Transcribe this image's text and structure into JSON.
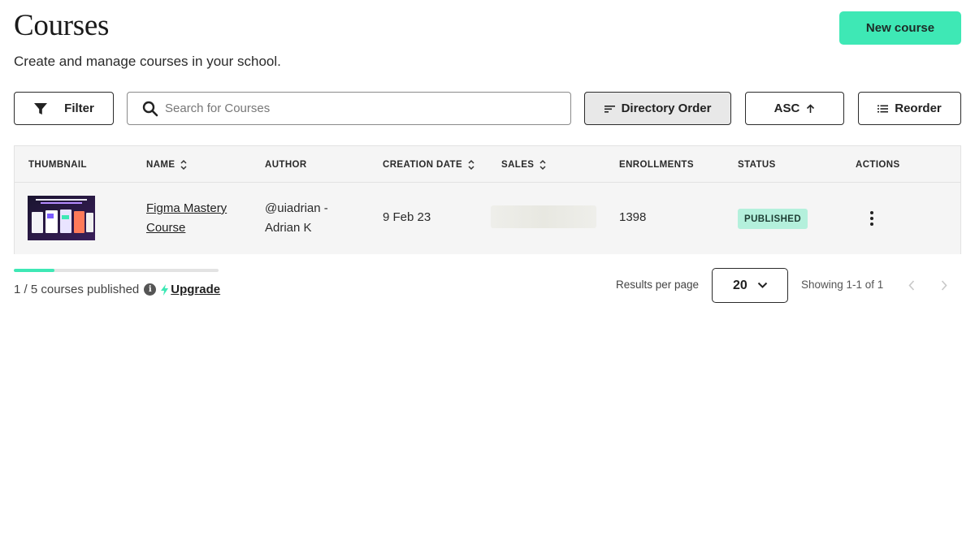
{
  "header": {
    "title": "Courses",
    "subtitle": "Create and manage courses in your school.",
    "new_course_label": "New course"
  },
  "toolbar": {
    "filter_label": "Filter",
    "search_placeholder": "Search for Courses",
    "sort_field_label": "Directory Order",
    "sort_direction_label": "ASC",
    "reorder_label": "Reorder"
  },
  "table": {
    "columns": [
      "THUMBNAIL",
      "NAME",
      "AUTHOR",
      "CREATION DATE",
      "SALES",
      "ENROLLMENTS",
      "STATUS",
      "ACTIONS"
    ],
    "rows": [
      {
        "name_line1": "Figma Mastery",
        "name_line2": "Course",
        "author_line1": "@uiadrian -",
        "author_line2": "Adrian K",
        "creation_date": "9 Feb 23",
        "enrollments": "1398",
        "status": "PUBLISHED"
      }
    ]
  },
  "footer": {
    "published_progress": 0.2,
    "published_text": "1 / 5 courses published",
    "upgrade_label": "Upgrade",
    "results_per_page_label": "Results per page",
    "per_page_value": "20",
    "showing_text": "Showing 1-1 of 1"
  },
  "colors": {
    "accent": "#3ee8b5",
    "status_badge_bg": "#b4f0dc",
    "table_bg": "#f5f5f5"
  },
  "icons": [
    "filter-icon",
    "search-icon",
    "sort-lines-icon",
    "arrow-up-icon",
    "list-icon",
    "sort-updown-icon",
    "kebab-menu-icon",
    "info-icon",
    "lightning-icon",
    "chevron-down-icon",
    "chevron-left-icon",
    "chevron-right-icon"
  ]
}
